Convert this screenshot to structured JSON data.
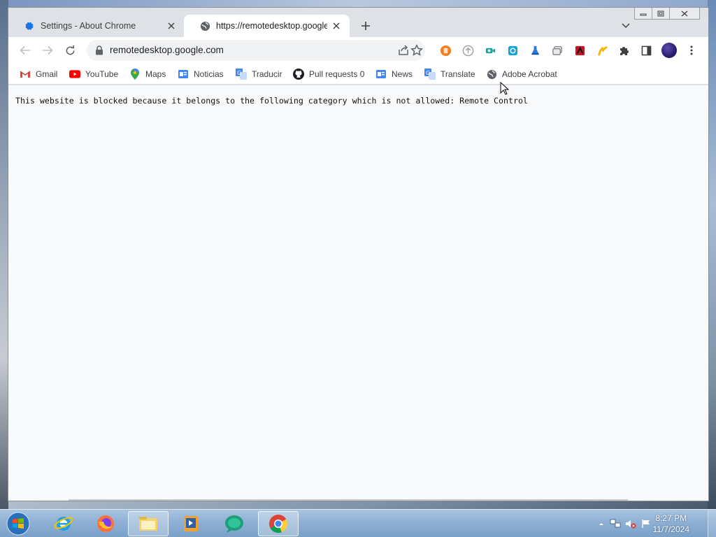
{
  "browser": {
    "tabs": [
      {
        "title": "Settings - About Chrome",
        "active": false,
        "icon": "gear-icon"
      },
      {
        "title": "https://remotedesktop.google.co",
        "active": true,
        "icon": "globe-icon"
      }
    ],
    "omnibox": {
      "url": "remotedesktop.google.com"
    },
    "bookmarks": [
      {
        "label": "Gmail",
        "icon": "gmail-icon"
      },
      {
        "label": "YouTube",
        "icon": "youtube-icon"
      },
      {
        "label": "Maps",
        "icon": "maps-icon"
      },
      {
        "label": "Noticias",
        "icon": "news-icon"
      },
      {
        "label": "Traducir",
        "icon": "translate-icon"
      },
      {
        "label": "Pull requests 0",
        "icon": "github-icon"
      },
      {
        "label": "News",
        "icon": "news-icon"
      },
      {
        "label": "Translate",
        "icon": "translate-icon"
      },
      {
        "label": "Adobe Acrobat",
        "icon": "globe-icon"
      }
    ],
    "page": {
      "message": "This website is blocked because it belongs to the following category which is not allowed: Remote Control"
    }
  },
  "taskbar": {
    "apps": [
      "internet-explorer-icon",
      "firefox-icon",
      "file-explorer-icon",
      "media-player-icon",
      "chat-icon",
      "chrome-icon"
    ],
    "clock": {
      "time": "8:27 PM",
      "date": "11/7/2024"
    }
  },
  "colors": {
    "accent_blue": "#1a73e8",
    "tab_strip": "#dee1e6",
    "page_bg": "#f8f9fa",
    "taskbar": "#8fb0d4"
  }
}
